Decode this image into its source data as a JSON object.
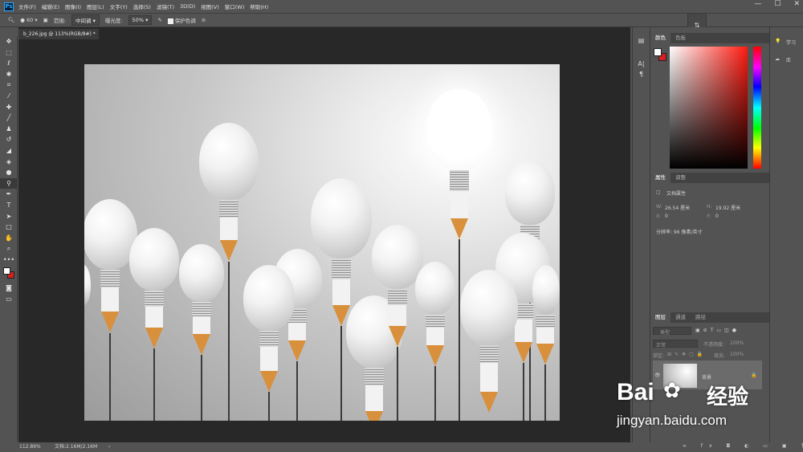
{
  "app": {
    "logo": "Ps"
  },
  "menu": [
    "文件(F)",
    "编辑(E)",
    "图像(I)",
    "图层(L)",
    "文字(Y)",
    "选择(S)",
    "滤镜(T)",
    "3D(D)",
    "视图(V)",
    "窗口(W)",
    "帮助(H)"
  ],
  "window_controls": {
    "minimize": "—",
    "maximize": "☐",
    "close": "✕"
  },
  "options": {
    "brush_size": "60",
    "range_label": "范围:",
    "range_value": "中间调",
    "exposure_label": "曝光度:",
    "exposure_value": "50%",
    "protect_tones": "保护色调"
  },
  "document": {
    "tab_title": "b_226.jpg @ 113%(RGB/8#) *"
  },
  "status": {
    "zoom": "112.89%",
    "doc_size": "文档:2.16M/2.16M"
  },
  "color_panel": {
    "tabs": [
      "颜色",
      "色板"
    ],
    "fg_color": "#ffffff",
    "bg_color": "#d42020"
  },
  "properties_panel": {
    "tabs": [
      "属性",
      "调整"
    ],
    "section": "文档属性",
    "w_label": "W:",
    "w_value": "26.54 厘米",
    "h_label": "H:",
    "h_value": "19.92 厘米",
    "x_label": "X:",
    "x_value": "0",
    "y_label": "Y:",
    "y_value": "0",
    "resolution": "分辨率: 96 像素/英寸"
  },
  "layers_panel": {
    "tabs": [
      "图层",
      "通道",
      "路径"
    ],
    "filter_label": "类型",
    "blend_mode": "正常",
    "opacity_label": "不透明度:",
    "opacity_value": "100%",
    "lock_label": "锁定:",
    "fill_label": "填充:",
    "fill_value": "100%",
    "layer_name": "背景"
  },
  "learn_panel": {
    "learn": "学习",
    "library": "库"
  },
  "watermark": {
    "brand": "Bai",
    "brand_cn": "经验",
    "url": "jingyan.baidu.com"
  }
}
